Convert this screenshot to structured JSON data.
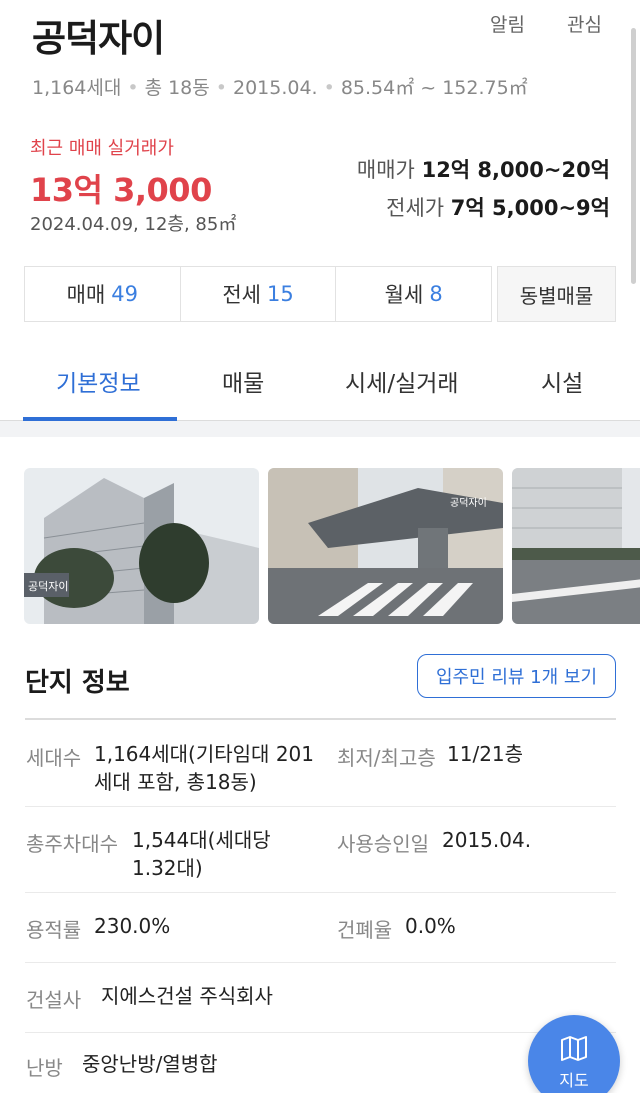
{
  "header": {
    "title": "공덕자이",
    "alarm_label": "알림",
    "favorite_label": "관심",
    "meta": [
      "1,164세대",
      "총 18동",
      "2015.04.",
      "85.54㎡ ~ 152.75㎡"
    ]
  },
  "price": {
    "recent_label": "최근 매매 실거래가",
    "recent_price": "13억 3,000",
    "recent_detail": "2024.04.09, 12층, 85㎡",
    "sale_label": "매매가",
    "sale_range": "12억 8,000~20억",
    "jeonse_label": "전세가",
    "jeonse_range": "7억 5,000~9억"
  },
  "counts": [
    {
      "label": "매매",
      "value": "49"
    },
    {
      "label": "전세",
      "value": "15"
    },
    {
      "label": "월세",
      "value": "8"
    }
  ],
  "dong_button": "동별매물",
  "tabs": [
    "기본정보",
    "매물",
    "시세/실거래",
    "시설"
  ],
  "active_tab": "기본정보",
  "photo1_sign": "공덕자이",
  "photo2_sign": "공덕자이",
  "info": {
    "title": "단지 정보",
    "review_button": "입주민 리뷰 1개 보기",
    "rows": [
      {
        "label": "세대수",
        "value_line1": "1,164세대(기타임대 201",
        "value_line2": "세대 포함, 총18동)",
        "label2": "최저/최고층",
        "value2": "11/21층"
      },
      {
        "label": "총주차대수",
        "value_line1": "1,544대(세대당",
        "value_line2": "1.32대)",
        "label2": "사용승인일",
        "value2": "2015.04."
      },
      {
        "label": "용적률",
        "value_line1": "230.0%",
        "label2": "건폐율",
        "value2": "0.0%"
      },
      {
        "label": "건설사",
        "value_line1": "지에스건설 주식회사"
      },
      {
        "label": "난방",
        "value_line1": "중앙난방/열병합"
      }
    ]
  },
  "map_fab_label": "지도",
  "colors": {
    "accent_blue": "#2f6fd6",
    "price_red": "#e0434b",
    "fab_blue": "#4a86e8"
  }
}
